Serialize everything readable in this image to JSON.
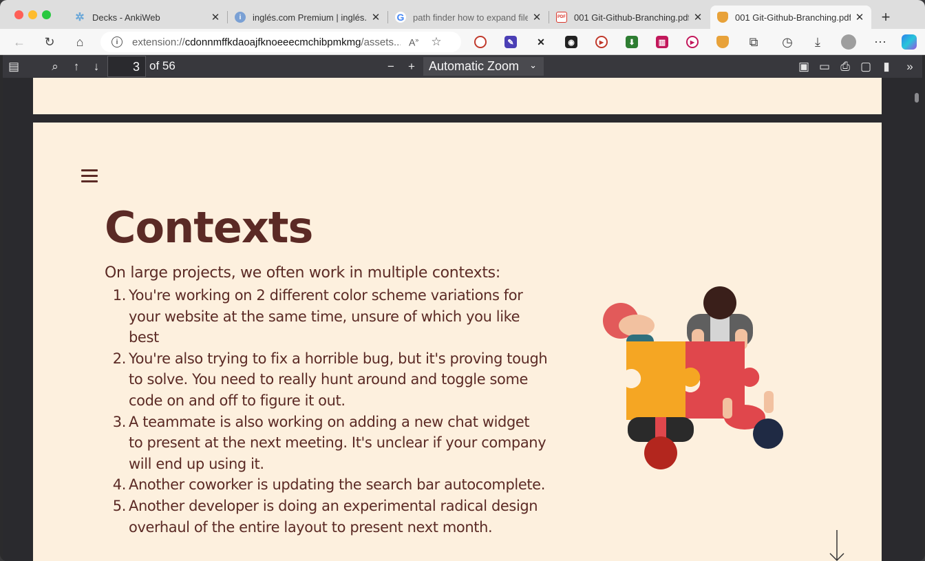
{
  "tabs": [
    {
      "title": "Decks - AnkiWeb",
      "icon": "star-icon",
      "color": "#6aa7d8",
      "active": false
    },
    {
      "title": "inglés.com Premium | inglés.com",
      "icon": "info-icon",
      "color": "#7aa0d4",
      "active": false
    },
    {
      "title": "path finder how to expand files",
      "icon": "google-icon",
      "color": "#4285f4",
      "active": false
    },
    {
      "title": "001 Git-Github-Branching.pdf",
      "icon": "pdf-icon",
      "color": "#d9352a",
      "active": false
    },
    {
      "title": "001 Git-Github-Branching.pdf",
      "icon": "shield-icon",
      "color": "#e8a23a",
      "active": true
    }
  ],
  "address": {
    "scheme": "extension://",
    "host": "cdonnmffkdaoajfknoeeecmchibpmkmg",
    "path": "/assets..."
  },
  "pdf_toolbar": {
    "page_current": "3",
    "page_total": "of 56",
    "zoom": "Automatic Zoom"
  },
  "slide": {
    "title": "Contexts",
    "intro": "On large projects, we often work in multiple contexts:",
    "items": [
      {
        "num": "1.",
        "lines": [
          "You're working on 2 different color scheme variations for",
          "your website at the same time, unsure of which you like best"
        ]
      },
      {
        "num": "2.",
        "lines": [
          "You're also trying to fix a horrible bug, but it's proving tough",
          "to solve.  You need to really hunt around and toggle some",
          "code on and off to figure it out."
        ]
      },
      {
        "num": "3.",
        "lines": [
          "A teammate is also working on adding a new chat widget",
          "to present at the next meeting.  It's unclear if your company",
          "will end up using it."
        ]
      },
      {
        "num": "4.",
        "lines": [
          "Another coworker is updating the search bar autocomplete."
        ]
      },
      {
        "num": "5.",
        "lines": [
          "Another developer is doing an experimental radical design",
          "overhaul of the entire layout to present next month."
        ]
      }
    ]
  },
  "colors": {
    "page_bg": "#fdf0de",
    "text": "#5b2a25",
    "puzzle_yellow": "#f5a623",
    "puzzle_red": "#e0474c"
  }
}
